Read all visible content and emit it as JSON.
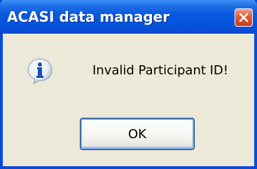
{
  "window": {
    "title": "ACASI data manager",
    "close_icon": "close-icon",
    "title_color": "#0454dc",
    "close_color": "#e1603c"
  },
  "dialog": {
    "icon": "info-icon",
    "message": "Invalid Participant ID!",
    "ok_label": "OK"
  }
}
